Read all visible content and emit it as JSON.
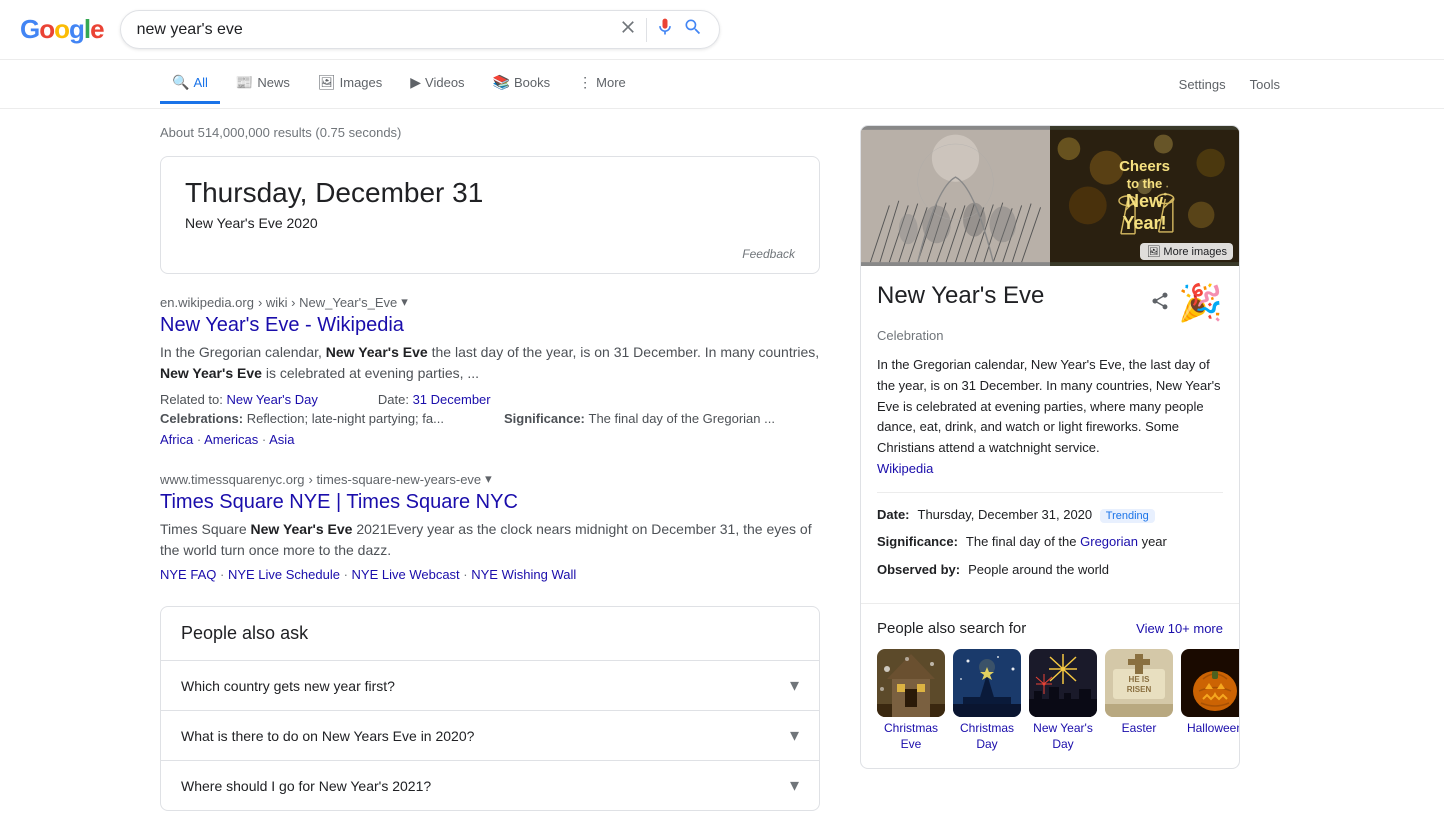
{
  "header": {
    "logo": "Google",
    "search_query": "new year's eve",
    "clear_label": "×",
    "search_button_label": "Search"
  },
  "nav": {
    "tabs": [
      {
        "id": "all",
        "label": "All",
        "active": true,
        "icon": "🔍"
      },
      {
        "id": "news",
        "label": "News",
        "active": false,
        "icon": "📰"
      },
      {
        "id": "images",
        "label": "Images",
        "active": false,
        "icon": "🖼"
      },
      {
        "id": "videos",
        "label": "Videos",
        "active": false,
        "icon": "▶"
      },
      {
        "id": "books",
        "label": "Books",
        "active": false,
        "icon": "📚"
      },
      {
        "id": "more",
        "label": "More",
        "active": false,
        "icon": "⋮"
      }
    ],
    "settings": "Settings",
    "tools": "Tools"
  },
  "results_count": "About 514,000,000 results (0.75 seconds)",
  "date_card": {
    "date": "Thursday, December 31",
    "subtitle": "New Year's Eve 2020",
    "feedback": "Feedback"
  },
  "results": [
    {
      "url_domain": "en.wikipedia.org",
      "url_path": "› wiki › New_Year's_Eve",
      "title": "New Year's Eve - Wikipedia",
      "title_href": "#",
      "snippet": "In the Gregorian calendar, New Year's Eve the last day of the year, is on 31 December. In many countries, New Year's Eve is celebrated at evening parties, ...",
      "snippet_bolds": [
        "New Year's Eve",
        "New Year's Eve"
      ],
      "meta_left_label": "Related to:",
      "meta_left_value": "New Year's Day",
      "meta_right_label": "Date:",
      "meta_right_value": "31 December",
      "significance_label": "Celebrations:",
      "significance_value": "Reflection; late-night partying; fa...",
      "significance2_label": "Significance:",
      "significance2_value": "The final day of the Gregorian ...",
      "links": [
        "Africa",
        "Americas",
        "Asia"
      ]
    },
    {
      "url_domain": "www.timessquarenyc.org",
      "url_path": "› times-square-new-years-eve",
      "title": "Times Square NYE | Times Square NYC",
      "title_href": "#",
      "snippet": "Times Square New Year's Eve 2021Every year as the clock nears midnight on December 31, the eyes of the world turn once more to the dazz.",
      "snippet_bolds": [
        "New Year's Eve"
      ],
      "links": [
        "NYE FAQ",
        "NYE Live Schedule",
        "NYE Live Webcast",
        "NYE Wishing Wall"
      ]
    }
  ],
  "paa": {
    "title": "People also ask",
    "questions": [
      "Which country gets new year first?",
      "What is there to do on New Years Eve in 2020?",
      "Where should I go for New Year's 2021?"
    ]
  },
  "knowledge_panel": {
    "title": "New Year's Eve",
    "subtitle": "Celebration",
    "emoji": "🎉",
    "description": "In the Gregorian calendar, New Year's Eve, the last day of the year, is on 31 December. In many countries, New Year's Eve is celebrated at evening parties, where many people dance, eat, drink, and watch or light fireworks. Some Christians attend a watchnight service.",
    "wikipedia_link": "Wikipedia",
    "date_label": "Date:",
    "date_value": "Thursday, December 31, 2020",
    "trending_label": "Trending",
    "significance_label": "Significance:",
    "significance_value": "The final day of the",
    "significance_link": "Gregorian",
    "significance_rest": "year",
    "observed_label": "Observed by:",
    "observed_value": "People around the world",
    "right_img_text1": "Cheers",
    "right_img_text2": "to the",
    "right_img_text3": "New",
    "right_img_text4": "Year!",
    "more_images": "More images"
  },
  "people_search": {
    "title": "People also search for",
    "view_more": "View 10+ more",
    "items": [
      {
        "label": "Christmas Eve",
        "color": "#8B6914"
      },
      {
        "label": "Christmas Day",
        "color": "#1a3a6b"
      },
      {
        "label": "New Year's Day",
        "color": "#c87941"
      },
      {
        "label": "Easter",
        "color": "#d4c8a8"
      },
      {
        "label": "Halloween",
        "color": "#b85c00"
      }
    ]
  }
}
